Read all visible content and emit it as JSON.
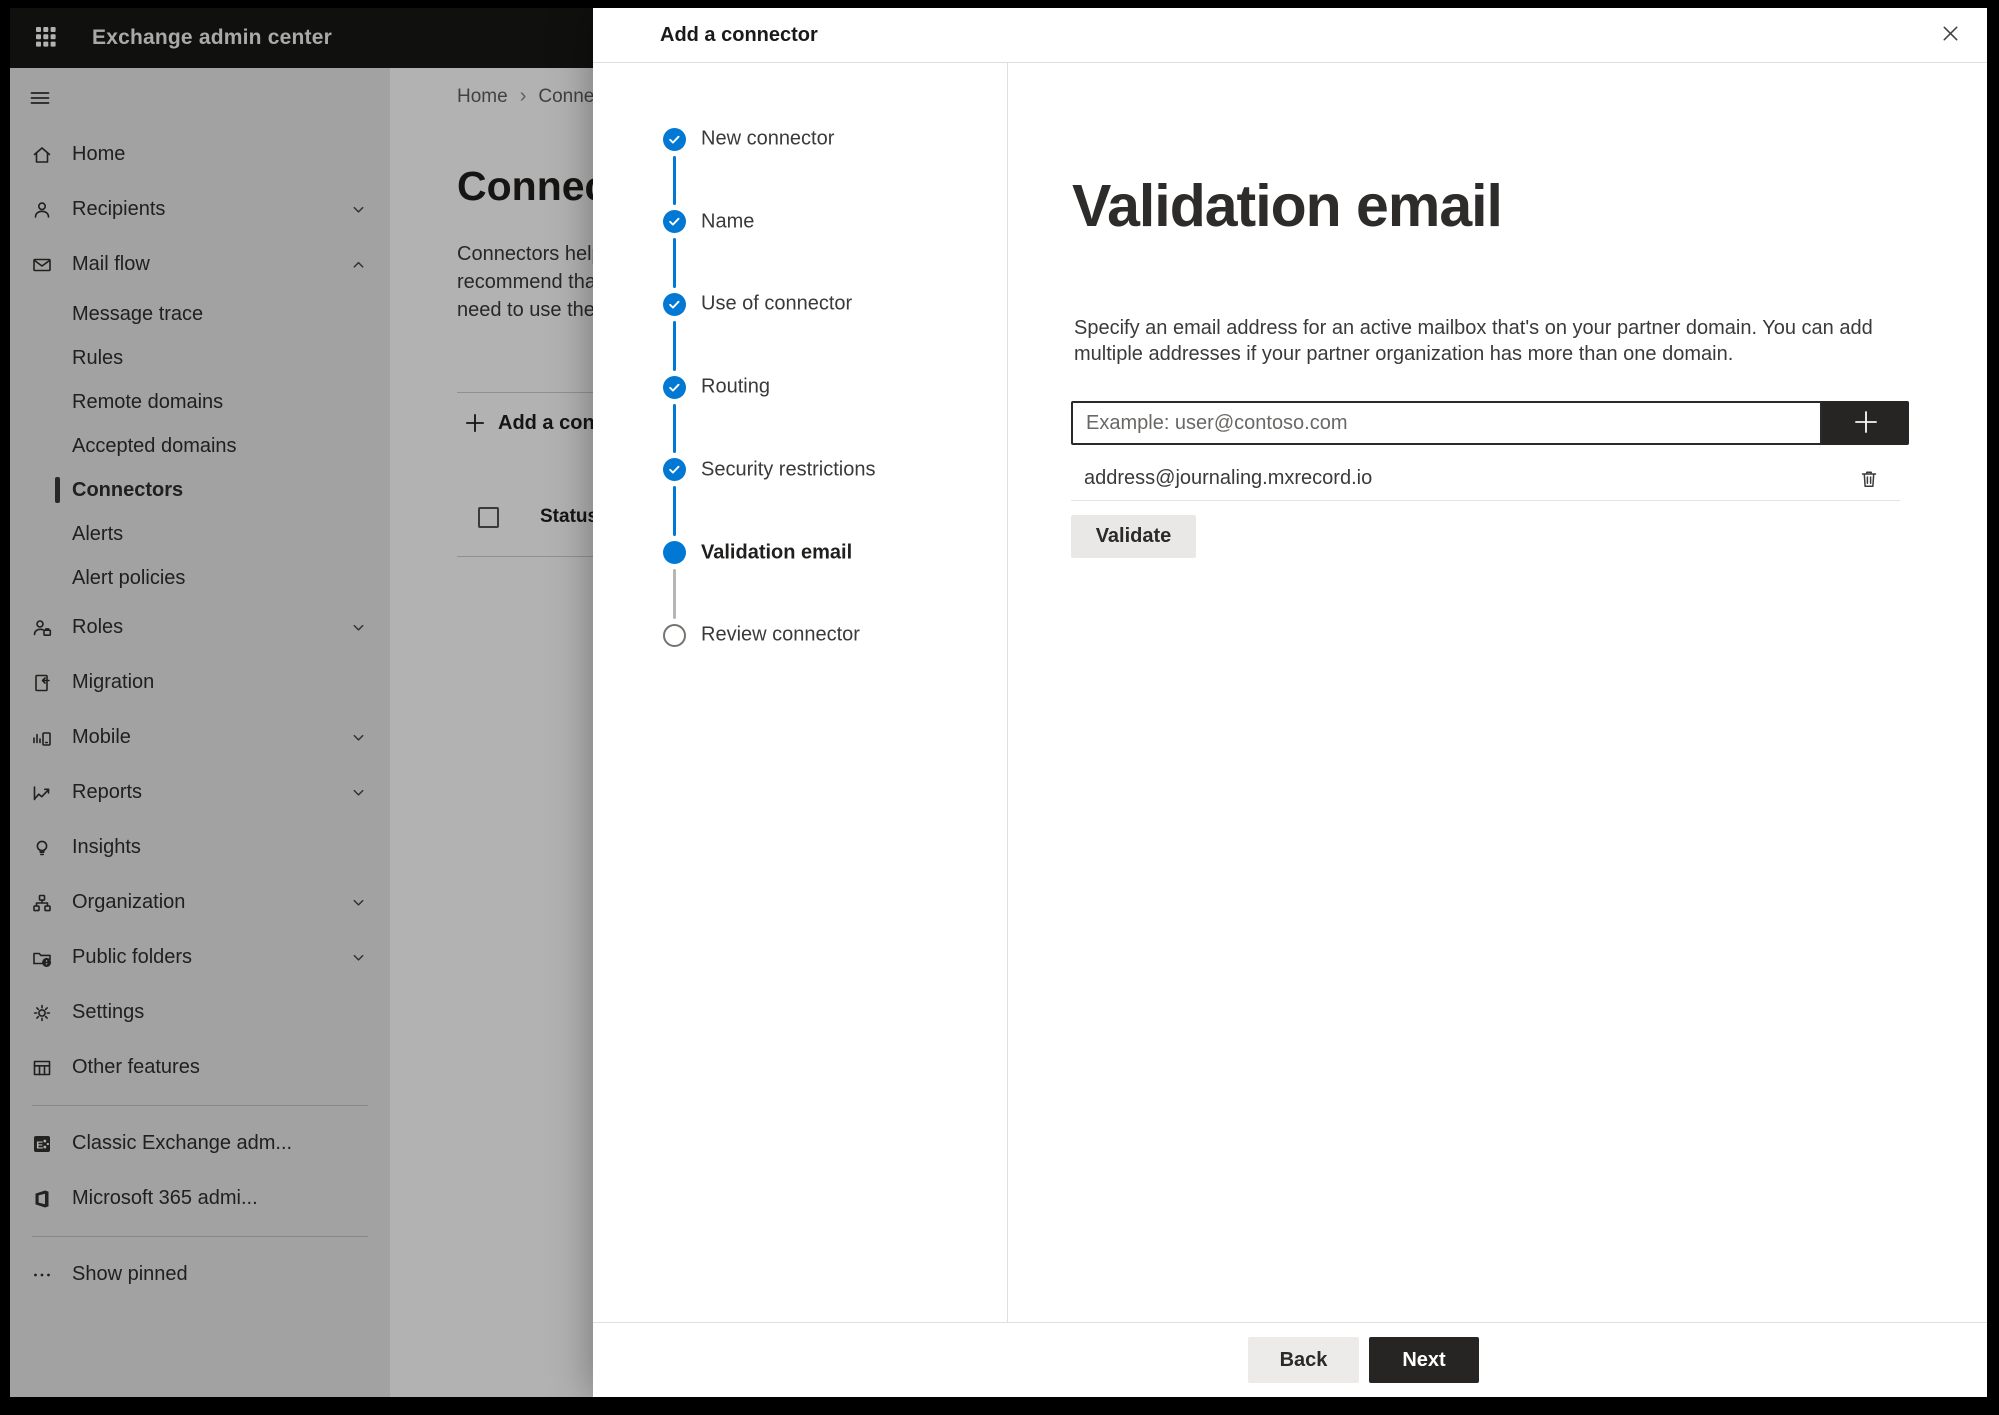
{
  "app_header": {
    "title": "Exchange admin center"
  },
  "sidebar": {
    "items": [
      {
        "label": "Home",
        "icon": "home-icon",
        "type": "main"
      },
      {
        "label": "Recipients",
        "icon": "person-icon",
        "type": "main",
        "chevron": "down"
      },
      {
        "label": "Mail flow",
        "icon": "mail-icon",
        "type": "main",
        "chevron": "up"
      },
      {
        "label": "Message trace",
        "type": "sub"
      },
      {
        "label": "Rules",
        "type": "sub"
      },
      {
        "label": "Remote domains",
        "type": "sub"
      },
      {
        "label": "Accepted domains",
        "type": "sub"
      },
      {
        "label": "Connectors",
        "type": "sub",
        "selected": true
      },
      {
        "label": "Alerts",
        "type": "sub"
      },
      {
        "label": "Alert policies",
        "type": "sub"
      },
      {
        "label": "Roles",
        "icon": "roles-icon",
        "type": "main",
        "chevron": "down"
      },
      {
        "label": "Migration",
        "icon": "migration-icon",
        "type": "main"
      },
      {
        "label": "Mobile",
        "icon": "mobile-icon",
        "type": "main",
        "chevron": "down"
      },
      {
        "label": "Reports",
        "icon": "reports-icon",
        "type": "main",
        "chevron": "down"
      },
      {
        "label": "Insights",
        "icon": "insights-icon",
        "type": "main"
      },
      {
        "label": "Organization",
        "icon": "organization-icon",
        "type": "main",
        "chevron": "down"
      },
      {
        "label": "Public folders",
        "icon": "public-folders-icon",
        "type": "main",
        "chevron": "down"
      },
      {
        "label": "Settings",
        "icon": "settings-icon",
        "type": "main"
      },
      {
        "label": "Other features",
        "icon": "other-features-icon",
        "type": "main"
      },
      {
        "type": "divider"
      },
      {
        "label": "Classic Exchange adm...",
        "icon": "classic-exchange-icon",
        "type": "main"
      },
      {
        "label": "Microsoft 365 admi...",
        "icon": "microsoft-365-icon",
        "type": "main"
      },
      {
        "type": "divider"
      },
      {
        "label": "Show pinned",
        "icon": "ellipsis-icon",
        "type": "main"
      }
    ]
  },
  "background_page": {
    "breadcrumb": {
      "items": [
        "Home",
        "Connectors"
      ],
      "separator": "›"
    },
    "title": "Connectors",
    "description_lines": [
      "Connectors help",
      "recommend that",
      "need to use them"
    ],
    "add_connector_label": "Add a connector",
    "table": {
      "status_column": "Status"
    }
  },
  "dialog": {
    "title": "Add a connector",
    "wizard_steps": [
      {
        "label": "New connector",
        "state": "complete"
      },
      {
        "label": "Name",
        "state": "complete"
      },
      {
        "label": "Use of connector",
        "state": "complete"
      },
      {
        "label": "Routing",
        "state": "complete"
      },
      {
        "label": "Security restrictions",
        "state": "complete"
      },
      {
        "label": "Validation email",
        "state": "current"
      },
      {
        "label": "Review connector",
        "state": "upcoming"
      }
    ],
    "content": {
      "heading": "Validation email",
      "description": "Specify an email address for an active mailbox that's on your partner domain. You can add multiple addresses if your partner organization has more than one domain.",
      "email_placeholder": "Example: user@contoso.com",
      "added_addresses": [
        "address@journaling.mxrecord.io"
      ],
      "validate_label": "Validate"
    },
    "footer": {
      "back_label": "Back",
      "next_label": "Next"
    }
  },
  "colors": {
    "accent_blue": "#0078d4",
    "primary_button_bg": "#262524",
    "secondary_button_bg": "#edebe9",
    "step_line_inactive": "#b8b6b4",
    "overlay": "rgba(0,0,0,0.30)"
  }
}
